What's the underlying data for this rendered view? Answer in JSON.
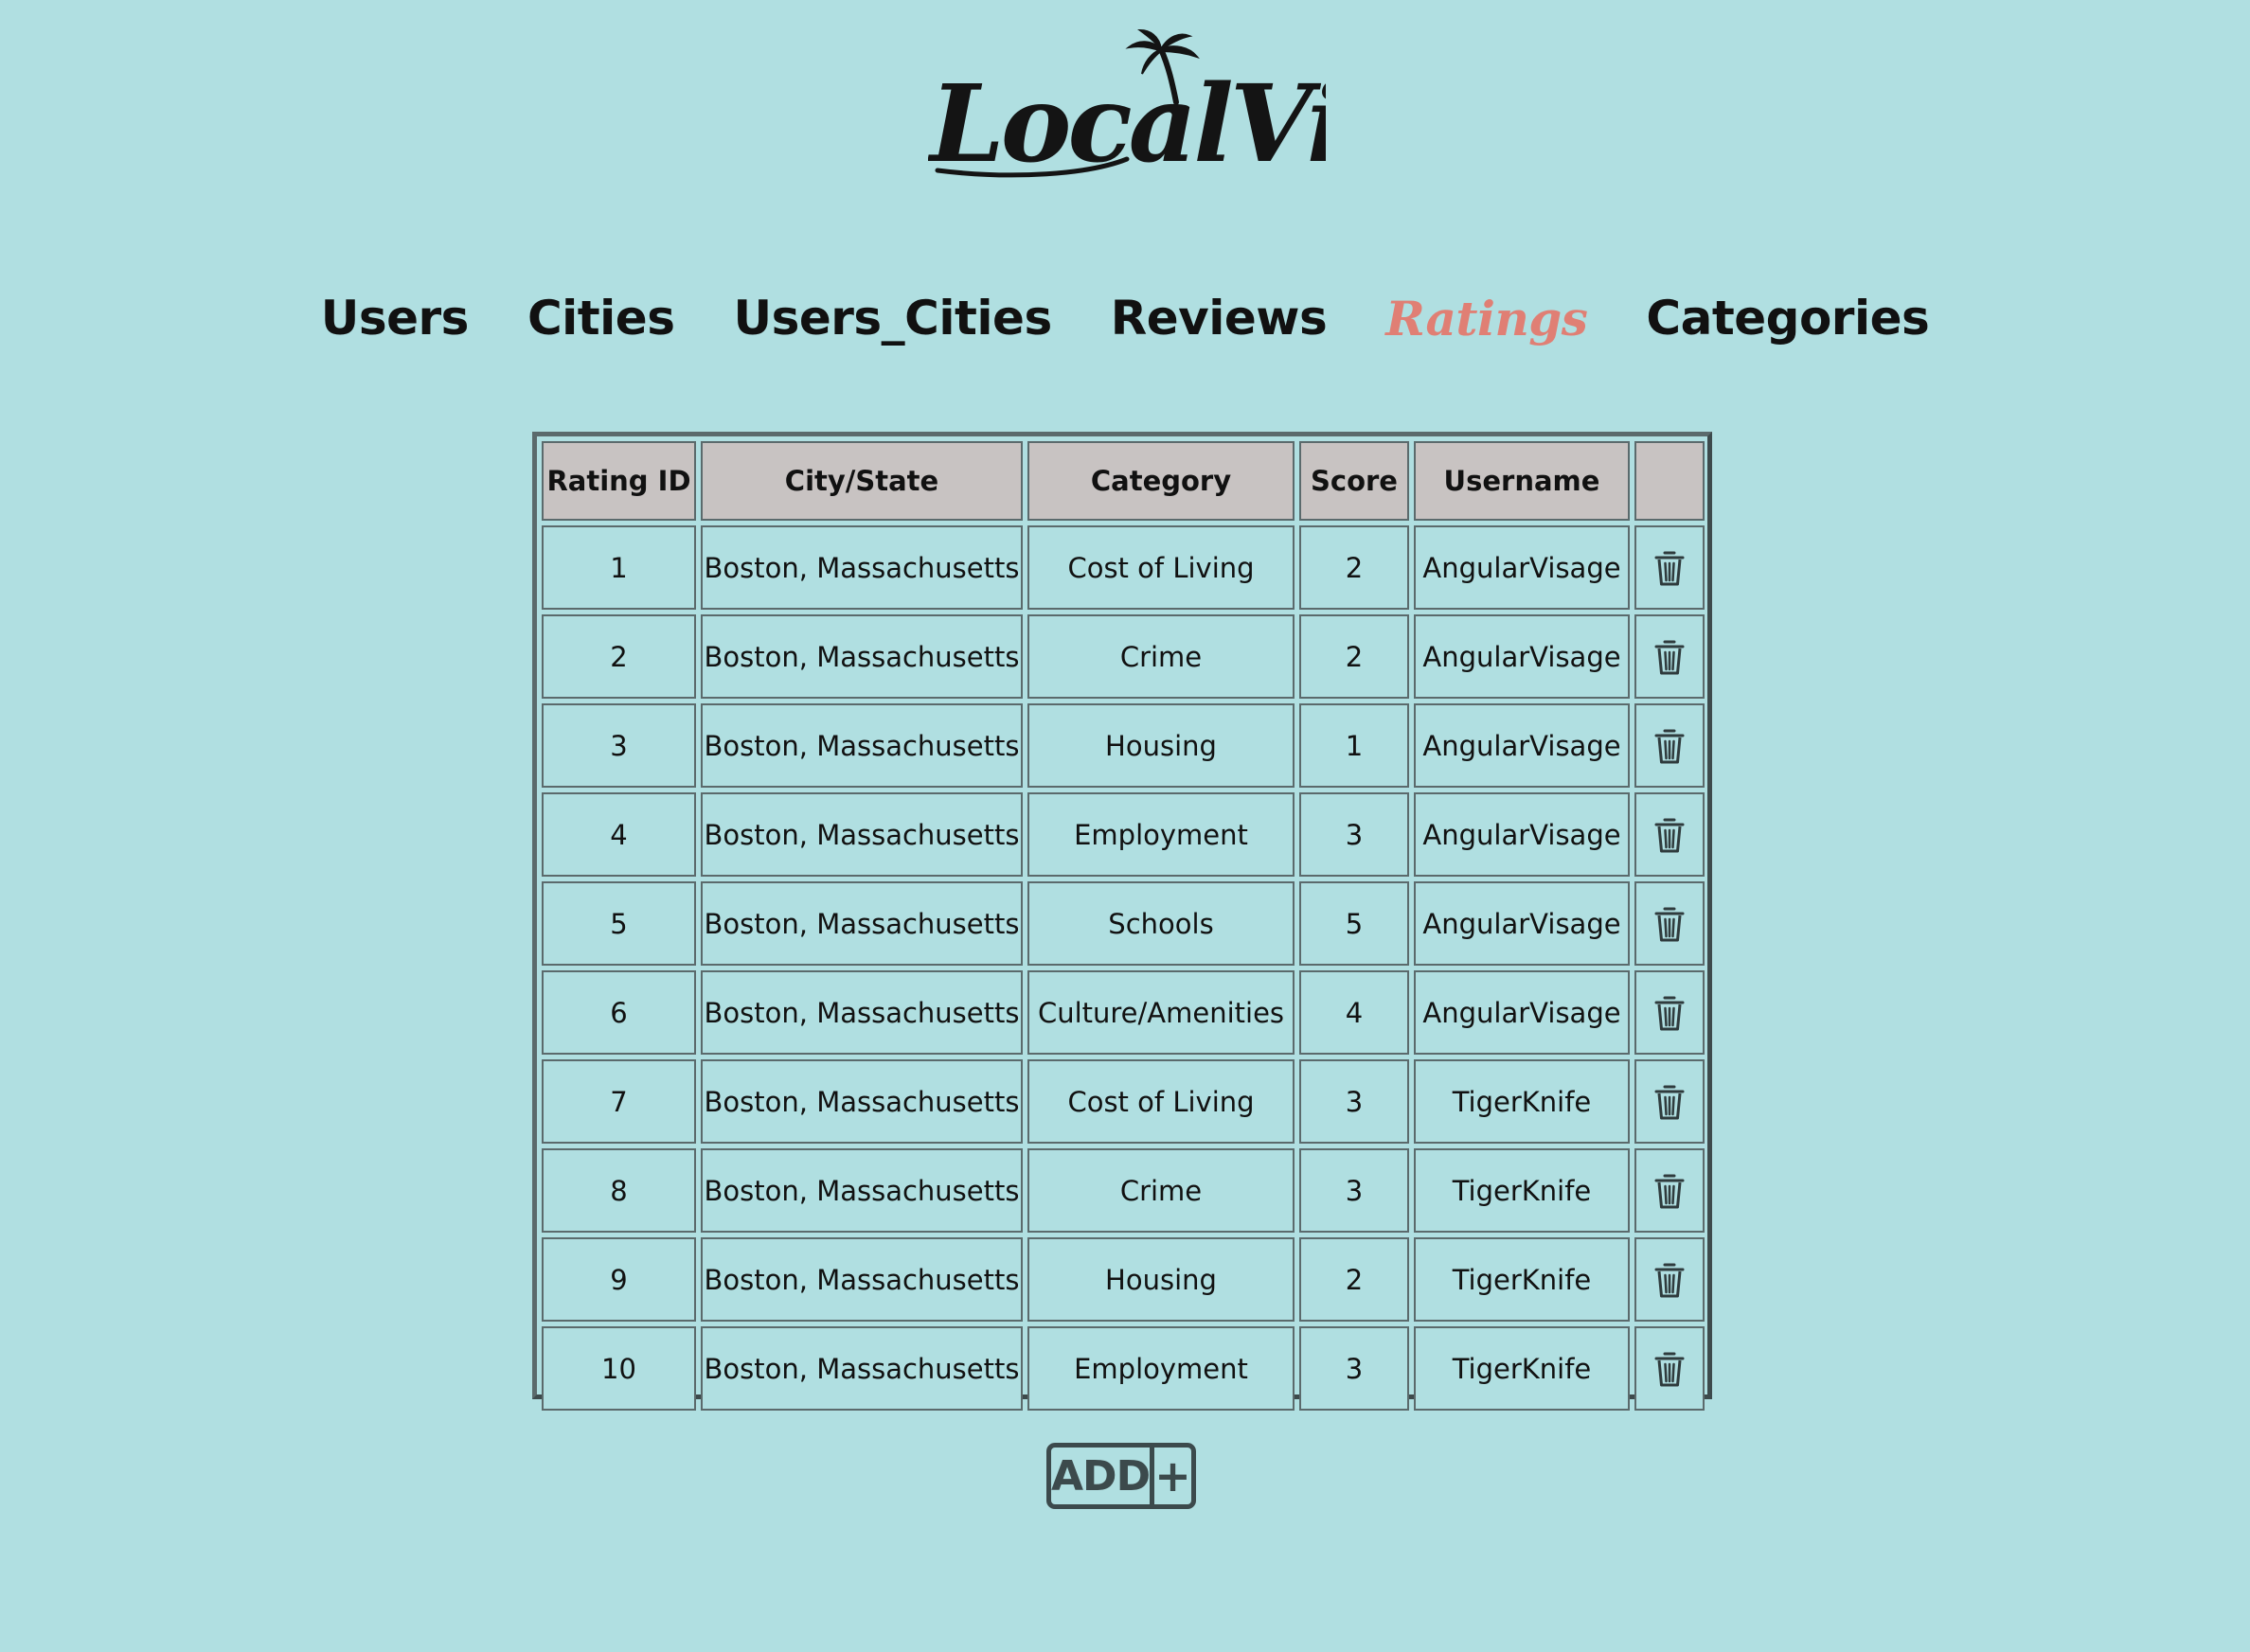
{
  "brand": {
    "logo_text": "LocalVibes"
  },
  "nav": {
    "items": [
      {
        "label": "Users",
        "active": false
      },
      {
        "label": "Cities",
        "active": false
      },
      {
        "label": "Users_Cities",
        "active": false
      },
      {
        "label": "Reviews",
        "active": false
      },
      {
        "label": "Ratings",
        "active": true
      },
      {
        "label": "Categories",
        "active": false
      }
    ]
  },
  "table": {
    "headers": [
      "Rating ID",
      "City/State",
      "Category",
      "Score",
      "Username",
      ""
    ],
    "rows": [
      {
        "id": "1",
        "city": "Boston, Massachusetts",
        "category": "Cost of Living",
        "score": "2",
        "username": "AngularVisage"
      },
      {
        "id": "2",
        "city": "Boston, Massachusetts",
        "category": "Crime",
        "score": "2",
        "username": "AngularVisage"
      },
      {
        "id": "3",
        "city": "Boston, Massachusetts",
        "category": "Housing",
        "score": "1",
        "username": "AngularVisage"
      },
      {
        "id": "4",
        "city": "Boston, Massachusetts",
        "category": "Employment",
        "score": "3",
        "username": "AngularVisage"
      },
      {
        "id": "5",
        "city": "Boston, Massachusetts",
        "category": "Schools",
        "score": "5",
        "username": "AngularVisage"
      },
      {
        "id": "6",
        "city": "Boston, Massachusetts",
        "category": "Culture/Amenities",
        "score": "4",
        "username": "AngularVisage"
      },
      {
        "id": "7",
        "city": "Boston, Massachusetts",
        "category": "Cost of Living",
        "score": "3",
        "username": "TigerKnife"
      },
      {
        "id": "8",
        "city": "Boston, Massachusetts",
        "category": "Crime",
        "score": "3",
        "username": "TigerKnife"
      },
      {
        "id": "9",
        "city": "Boston, Massachusetts",
        "category": "Housing",
        "score": "2",
        "username": "TigerKnife"
      },
      {
        "id": "10",
        "city": "Boston, Massachusetts",
        "category": "Employment",
        "score": "3",
        "username": "TigerKnife"
      }
    ],
    "row_action_icon": "trash-icon"
  },
  "add_button": {
    "label": "ADD",
    "icon": "+"
  },
  "colors": {
    "background": "#b0dfe1",
    "header_bg": "#c8c3c2",
    "active_nav": "#e07f74",
    "border": "#5b6a6c"
  }
}
